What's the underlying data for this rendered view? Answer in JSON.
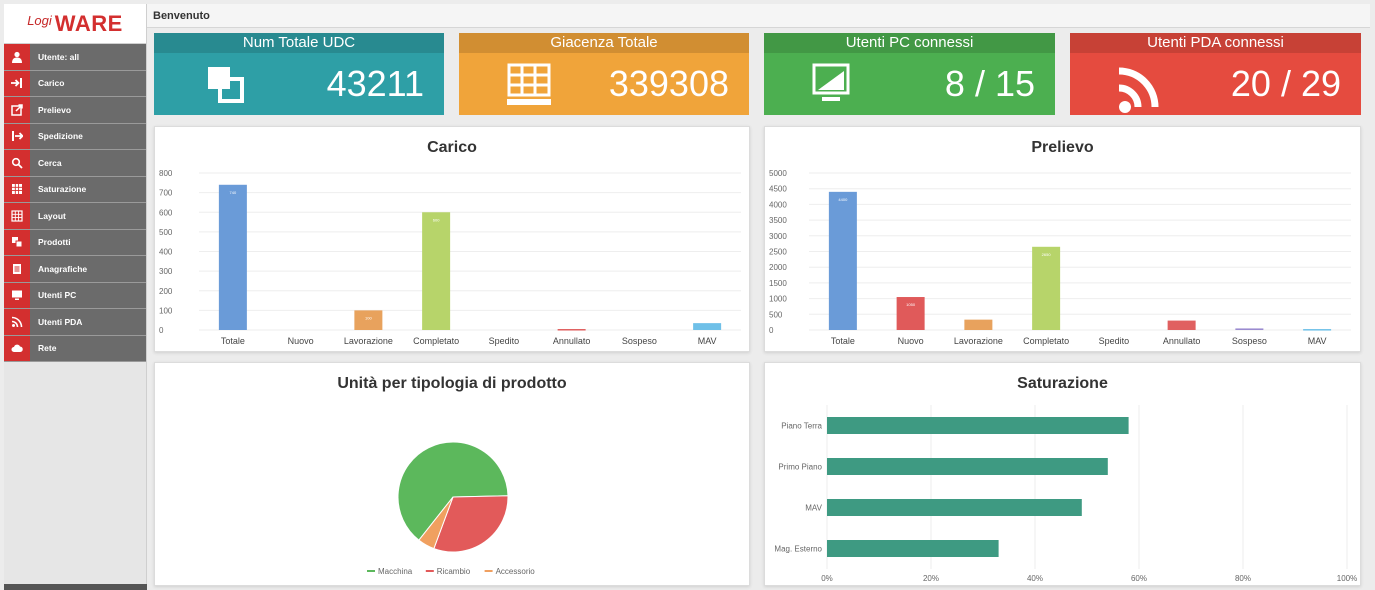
{
  "logo": {
    "prefix": "Logi",
    "name": "WARE"
  },
  "header": {
    "title": "Benvenuto"
  },
  "sidebar": {
    "items": [
      {
        "label": "Utente: all",
        "icon": "user-icon"
      },
      {
        "label": "Carico",
        "icon": "sign-in-icon"
      },
      {
        "label": "Prelievo",
        "icon": "external-link-icon"
      },
      {
        "label": "Spedizione",
        "icon": "sign-out-icon"
      },
      {
        "label": "Cerca",
        "icon": "search-icon"
      },
      {
        "label": "Saturazione",
        "icon": "grid-icon"
      },
      {
        "label": "Layout",
        "icon": "layout-icon"
      },
      {
        "label": "Prodotti",
        "icon": "boxes-icon"
      },
      {
        "label": "Anagrafiche",
        "icon": "document-icon"
      },
      {
        "label": "Utenti PC",
        "icon": "monitor-icon"
      },
      {
        "label": "Utenti PDA",
        "icon": "rss-icon"
      },
      {
        "label": "Rete",
        "icon": "cloud-icon"
      }
    ]
  },
  "cards": [
    {
      "title": "Num Totale UDC",
      "value": "43211",
      "icon": "udc-squares-icon",
      "color": "#2e9fa6"
    },
    {
      "title": "Giacenza Totale",
      "value": "339308",
      "icon": "grid-icon",
      "color": "#f0a43a"
    },
    {
      "title": "Utenti PC connessi",
      "value": "8 / 15",
      "icon": "monitor-icon",
      "color": "#4caf50"
    },
    {
      "title": "Utenti PDA connessi",
      "value": "20 / 29",
      "icon": "rss-icon",
      "color": "#e54b3f"
    }
  ],
  "chart_data": [
    {
      "type": "bar",
      "title": "Carico",
      "categories": [
        "Totale",
        "Nuovo",
        "Lavorazione",
        "Completato",
        "Spedito",
        "Annullato",
        "Sospeso",
        "MAV"
      ],
      "values": [
        740,
        0,
        100,
        600,
        0,
        5,
        0,
        35
      ],
      "colors": [
        "#6a9bd8",
        "#e05a5a",
        "#e8a25d",
        "#b7d46a",
        "#9b6bd0",
        "#e06060",
        "#9a8bd0",
        "#6fc0e8"
      ],
      "yticks": [
        "0",
        "100",
        "200",
        "300",
        "400",
        "500",
        "600",
        "700",
        "800"
      ],
      "ylim": [
        0,
        800
      ]
    },
    {
      "type": "bar",
      "title": "Prelievo",
      "categories": [
        "Totale",
        "Nuovo",
        "Lavorazione",
        "Completato",
        "Spedito",
        "Annullato",
        "Sospeso",
        "MAV"
      ],
      "values": [
        4400,
        1050,
        330,
        2650,
        0,
        300,
        50,
        30
      ],
      "colors": [
        "#6a9bd8",
        "#e05a5a",
        "#e8a25d",
        "#b7d46a",
        "#9b6bd0",
        "#e06060",
        "#9a8bd0",
        "#6fc0e8"
      ],
      "yticks": [
        "0",
        "500",
        "1000",
        "1500",
        "2000",
        "2500",
        "3000",
        "3500",
        "4000",
        "4500",
        "5000"
      ],
      "ylim": [
        0,
        5000
      ]
    },
    {
      "type": "pie",
      "title": "Unità per tipologia di prodotto",
      "labels": [
        "Macchina",
        "Ricambio",
        "Accessorio"
      ],
      "values": [
        64,
        31,
        5
      ],
      "colors": [
        "#5cb85c",
        "#e25a5a",
        "#f0a060"
      ]
    },
    {
      "type": "bar",
      "orientation": "horizontal",
      "title": "Saturazione",
      "categories": [
        "Piano Terra",
        "Primo Piano",
        "MAV",
        "Mag. Esterno"
      ],
      "values": [
        58,
        54,
        49,
        33
      ],
      "colors": [
        "#3e9a82"
      ],
      "xticks": [
        "0%",
        "20%",
        "40%",
        "60%",
        "80%",
        "100%"
      ],
      "xlim": [
        0,
        100
      ]
    }
  ]
}
